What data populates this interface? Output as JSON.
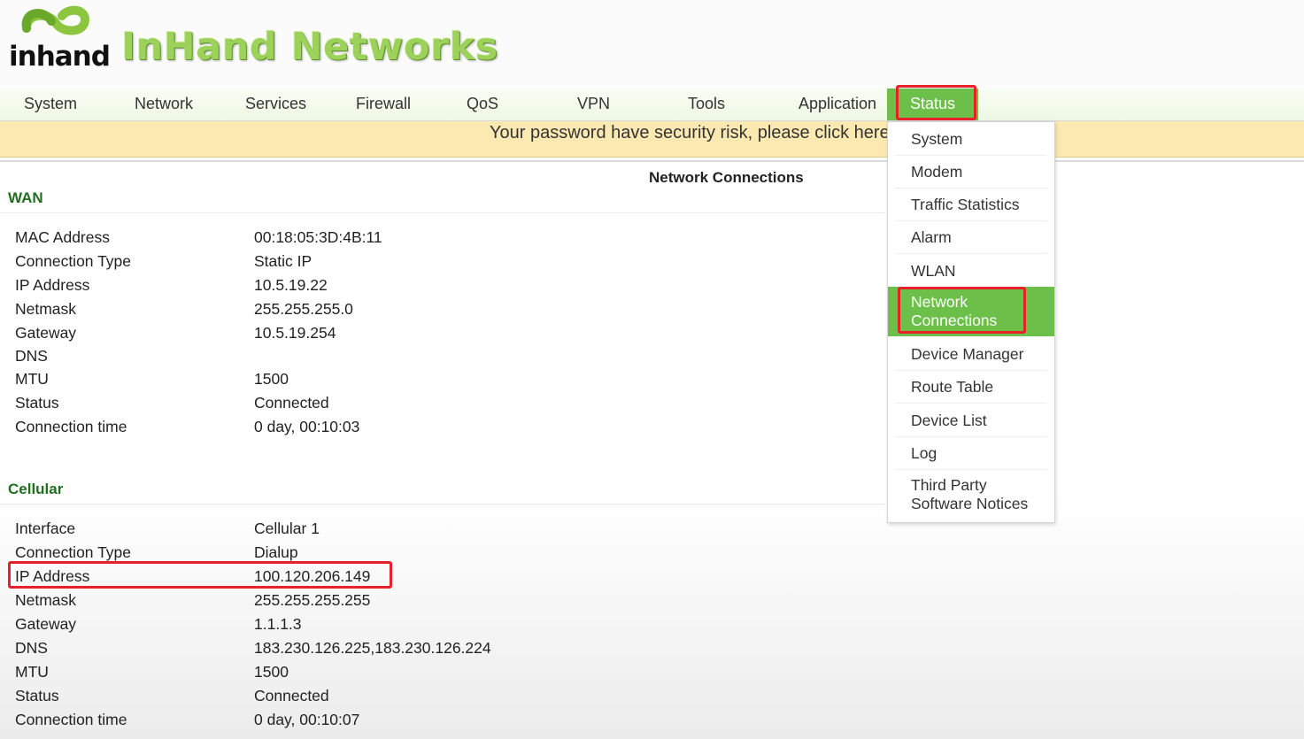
{
  "brand": {
    "logo_text": "inhand",
    "name": "InHand Networks",
    "accent_color": "#6cc04a",
    "highlight_color": "#e8202a"
  },
  "nav": {
    "items": [
      "System",
      "Network",
      "Services",
      "Firewall",
      "QoS",
      "VPN",
      "Tools",
      "Application",
      "Status"
    ],
    "active": "Status"
  },
  "banner": {
    "text": "Your password have security risk, please click here"
  },
  "page": {
    "title": "Network Connections"
  },
  "wan": {
    "title": "WAN",
    "rows": [
      {
        "label": "MAC Address",
        "value": "00:18:05:3D:4B:11"
      },
      {
        "label": "Connection Type",
        "value": "Static IP"
      },
      {
        "label": "IP Address",
        "value": "10.5.19.22"
      },
      {
        "label": "Netmask",
        "value": "255.255.255.0"
      },
      {
        "label": "Gateway",
        "value": "10.5.19.254"
      },
      {
        "label": "DNS",
        "value": ""
      },
      {
        "label": "MTU",
        "value": "1500"
      },
      {
        "label": "Status",
        "value": "Connected"
      },
      {
        "label": "Connection time",
        "value": "0 day, 00:10:03"
      }
    ]
  },
  "cellular": {
    "title": "Cellular",
    "rows": [
      {
        "label": "Interface",
        "value": "Cellular 1"
      },
      {
        "label": "Connection Type",
        "value": "Dialup"
      },
      {
        "label": "IP Address",
        "value": "100.120.206.149"
      },
      {
        "label": "Netmask",
        "value": "255.255.255.255"
      },
      {
        "label": "Gateway",
        "value": "1.1.1.3"
      },
      {
        "label": "DNS",
        "value": "183.230.126.225,183.230.126.224"
      },
      {
        "label": "MTU",
        "value": "1500"
      },
      {
        "label": "Status",
        "value": "Connected"
      },
      {
        "label": "Connection time",
        "value": "0 day, 00:10:07"
      }
    ]
  },
  "status_menu": {
    "items": [
      {
        "line1": "System",
        "line2": ""
      },
      {
        "line1": "Modem",
        "line2": ""
      },
      {
        "line1": "Traffic Statistics",
        "line2": ""
      },
      {
        "line1": "Alarm",
        "line2": ""
      },
      {
        "line1": "WLAN",
        "line2": ""
      },
      {
        "line1": "Network",
        "line2": "Connections"
      },
      {
        "line1": "Device Manager",
        "line2": ""
      },
      {
        "line1": "Route Table",
        "line2": ""
      },
      {
        "line1": "Device List",
        "line2": ""
      },
      {
        "line1": "Log",
        "line2": ""
      },
      {
        "line1": "Third Party",
        "line2": "Software Notices"
      }
    ],
    "active_index": 5
  }
}
